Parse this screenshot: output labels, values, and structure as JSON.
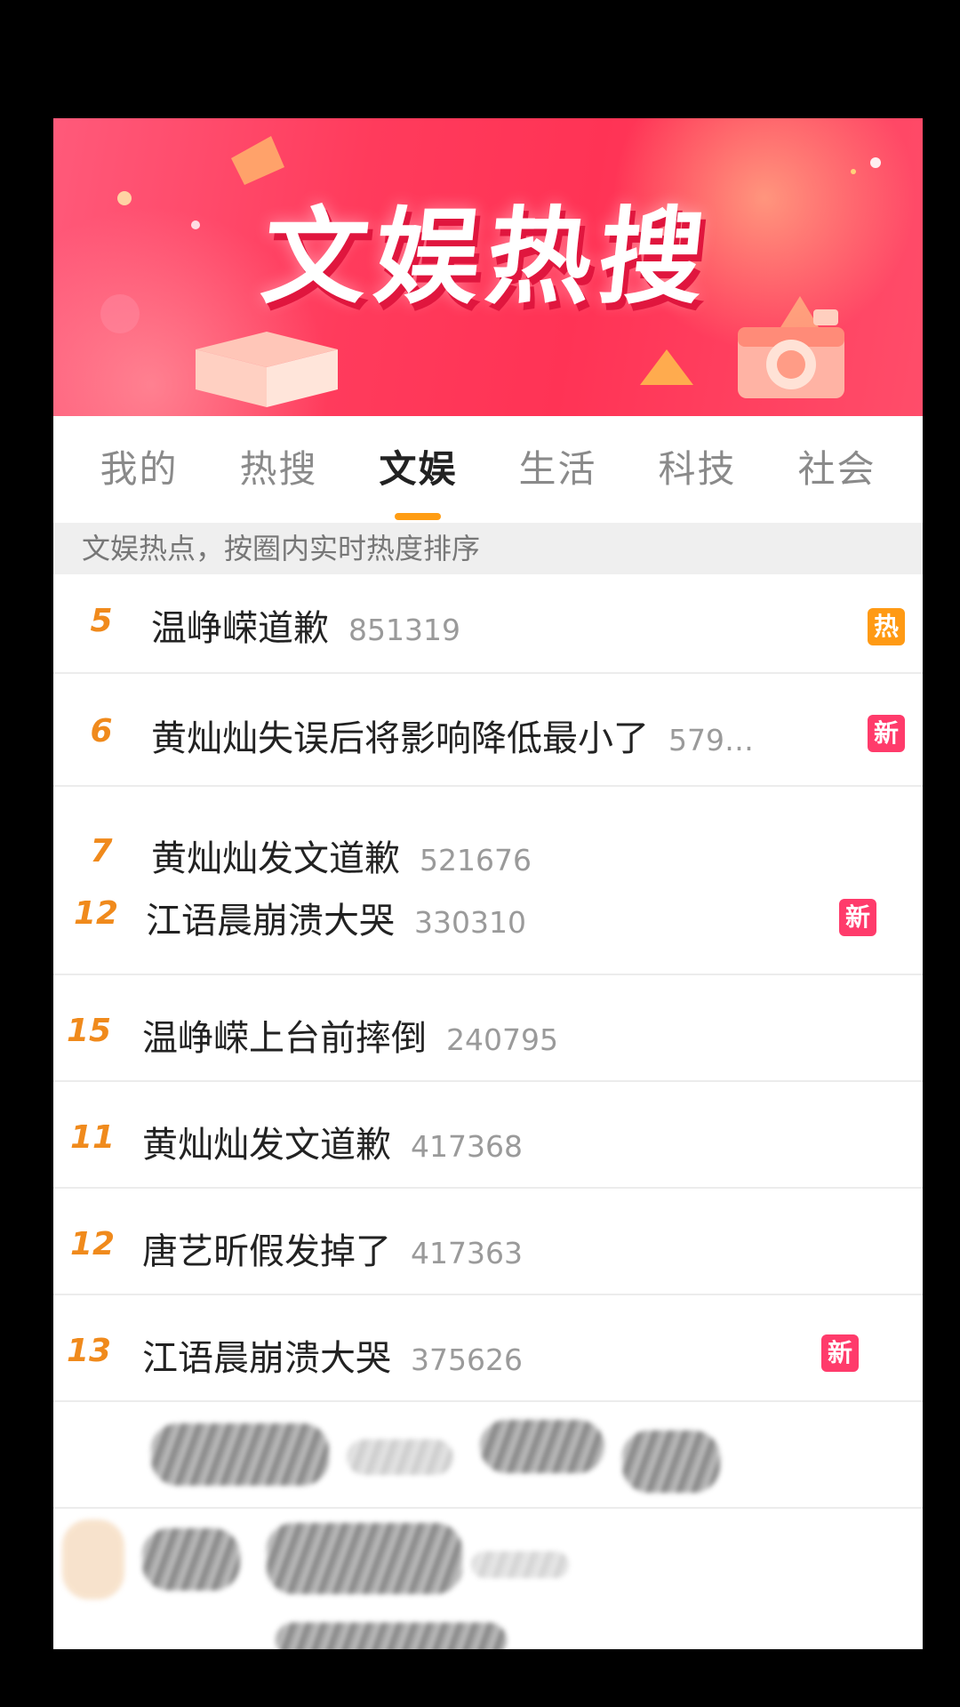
{
  "banner": {
    "title": "文娱热搜"
  },
  "tabs": [
    {
      "label": "我的"
    },
    {
      "label": "热搜"
    },
    {
      "label": "文娱"
    },
    {
      "label": "生活"
    },
    {
      "label": "科技"
    },
    {
      "label": "社会"
    }
  ],
  "active_tab": "文娱",
  "subtitle": "文娱热点，按圈内实时热度排序",
  "items": [
    {
      "rank": "5",
      "topic": "温峥嵘道歉",
      "count": "851319",
      "badge": "热"
    },
    {
      "rank": "6",
      "topic": "黄灿灿失误后将影响降低最小了",
      "count": "579…",
      "badge": "新"
    },
    {
      "rank": "7",
      "topic": "黄灿灿发文道歉",
      "count": "521676",
      "badge": ""
    },
    {
      "rank": "12",
      "topic": "江语晨崩溃大哭",
      "count": "330310",
      "badge": "新"
    },
    {
      "rank": "15",
      "topic": "温峥嵘上台前摔倒",
      "count": "240795",
      "badge": ""
    },
    {
      "rank": "11",
      "topic": "黄灿灿发文道歉",
      "count": "417368",
      "badge": ""
    },
    {
      "rank": "12",
      "topic": "唐艺昕假发掉了",
      "count": "417363",
      "badge": ""
    },
    {
      "rank": "13",
      "topic": "江语晨崩溃大哭",
      "count": "375626",
      "badge": "新"
    }
  ],
  "colors": {
    "accent_orange": "#f08a1c",
    "tab_indicator": "#ff9d14",
    "badge_hot": "#ff9a14",
    "badge_new": "#ff3b6b",
    "banner_red": "#ff3b5c"
  }
}
